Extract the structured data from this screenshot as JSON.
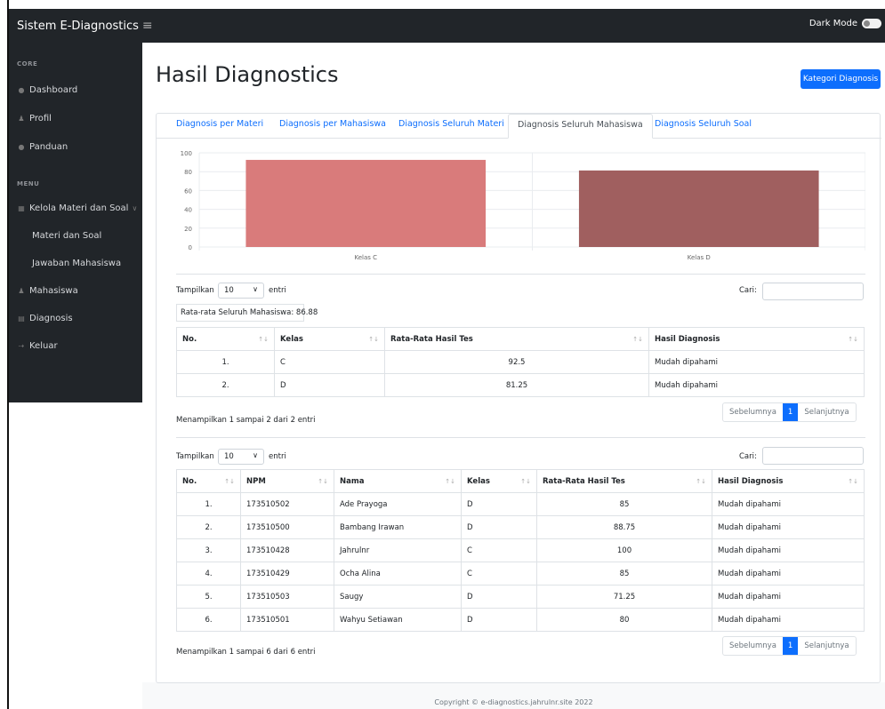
{
  "app": {
    "brand": "Sistem E-Diagnostics",
    "menu_icon": "hamburger-icon",
    "dark_mode_label": "Dark Mode"
  },
  "sidebar": {
    "core_heading": "CORE",
    "menu_heading": "MENU",
    "dashboard": "Dashboard",
    "profil": "Profil",
    "panduan": "Panduan",
    "kelola": "Kelola Materi dan Soal",
    "materi_soal": "Materi dan Soal",
    "jawaban": "Jawaban Mahasiswa",
    "mahasiswa": "Mahasiswa",
    "diagnosis": "Diagnosis",
    "keluar": "Keluar"
  },
  "page": {
    "title": "Hasil Diagnostics",
    "kategori_button": "Kategori Diagnosis"
  },
  "tabs": [
    {
      "label": "Diagnosis per Materi"
    },
    {
      "label": "Diagnosis per Mahasiswa"
    },
    {
      "label": "Diagnosis Seluruh Materi"
    },
    {
      "label": "Diagnosis Seluruh Mahasiswa"
    },
    {
      "label": "Diagnosis Seluruh Soal"
    }
  ],
  "chart_data": {
    "type": "bar",
    "categories": [
      "Kelas C",
      "Kelas D"
    ],
    "values": [
      92.5,
      81.25
    ],
    "colors": [
      "#d97b7b",
      "#a05f5f"
    ],
    "yticks": [
      0,
      20,
      40,
      60,
      80,
      100
    ],
    "ylim": [
      0,
      100
    ],
    "grid": true
  },
  "table1": {
    "show_label": "Tampilkan",
    "show_value": "10",
    "entries_label": "entri",
    "search_label": "Cari:",
    "average_text": "Rata-rata Seluruh Mahasiswa: 86.88",
    "headers": [
      "No.",
      "Kelas",
      "Rata-Rata Hasil Tes",
      "Hasil Diagnosis"
    ],
    "rows": [
      [
        "1.",
        "C",
        "92.5",
        "Mudah dipahami"
      ],
      [
        "2.",
        "D",
        "81.25",
        "Mudah dipahami"
      ]
    ],
    "info": "Menampilkan 1 sampai 2 dari 2 entri",
    "prev": "Sebelumnya",
    "page": "1",
    "next": "Selanjutnya"
  },
  "table2": {
    "show_label": "Tampilkan",
    "show_value": "10",
    "entries_label": "entri",
    "search_label": "Cari:",
    "headers": [
      "No.",
      "NPM",
      "Nama",
      "Kelas",
      "Rata-Rata Hasil Tes",
      "Hasil Diagnosis"
    ],
    "rows": [
      [
        "1.",
        "173510502",
        "Ade Prayoga",
        "D",
        "85",
        "Mudah dipahami"
      ],
      [
        "2.",
        "173510500",
        "Bambang Irawan",
        "D",
        "88.75",
        "Mudah dipahami"
      ],
      [
        "3.",
        "173510428",
        "Jahrulnr",
        "C",
        "100",
        "Mudah dipahami"
      ],
      [
        "4.",
        "173510429",
        "Ocha Alina",
        "C",
        "85",
        "Mudah dipahami"
      ],
      [
        "5.",
        "173510503",
        "Saugy",
        "D",
        "71.25",
        "Mudah dipahami"
      ],
      [
        "6.",
        "173510501",
        "Wahyu Setiawan",
        "D",
        "80",
        "Mudah dipahami"
      ]
    ],
    "info": "Menampilkan 1 sampai 6 dari 6 entri",
    "prev": "Sebelumnya",
    "page": "1",
    "next": "Selanjutnya"
  },
  "footer": {
    "text": "Copyright © e-diagnostics.jahrulnr.site 2022"
  }
}
